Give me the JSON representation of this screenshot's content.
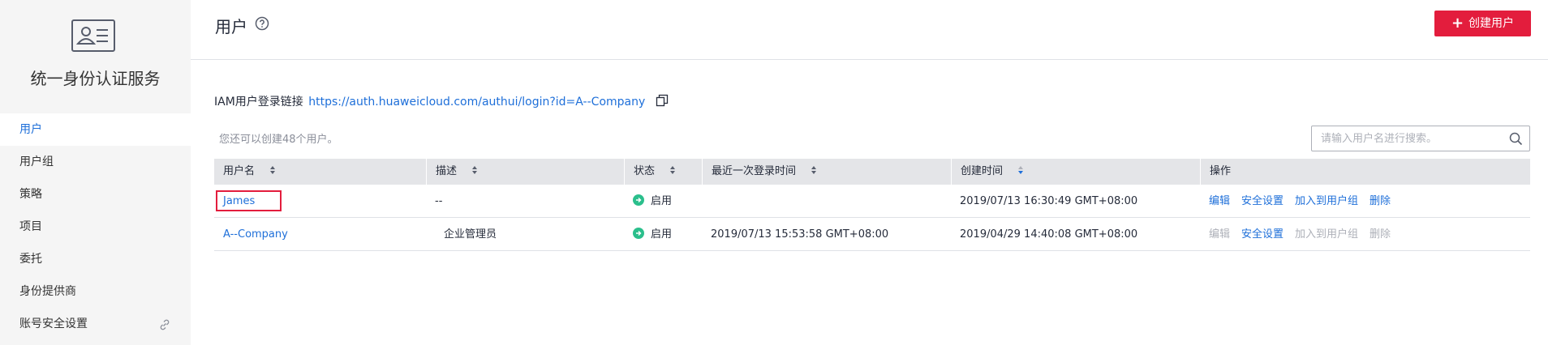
{
  "sidebar": {
    "title": "统一身份认证服务",
    "logo_icon": "id-card-icon",
    "items": [
      {
        "label": "用户",
        "active": true
      },
      {
        "label": "用户组"
      },
      {
        "label": "策略"
      },
      {
        "label": "项目"
      },
      {
        "label": "委托"
      },
      {
        "label": "身份提供商"
      },
      {
        "label": "账号安全设置",
        "icon": "link-icon"
      }
    ]
  },
  "header": {
    "title": "用户",
    "help_icon": "question-circle-icon",
    "create_button": "创建用户",
    "create_icon": "plus-icon"
  },
  "login_link": {
    "label": "IAM用户登录链接",
    "url": "https://auth.huaweicloud.com/authui/login?id=A--Company",
    "copy_icon": "copy-icon"
  },
  "quota_text": "您还可以创建48个用户。",
  "search": {
    "placeholder": "请输入用户名进行搜索。",
    "icon": "search-icon"
  },
  "table": {
    "columns": [
      "用户名",
      "描述",
      "状态",
      "最近一次登录时间",
      "创建时间",
      "操作"
    ],
    "rows": [
      {
        "username": "James",
        "description": "--",
        "status": "启用",
        "last_login": "",
        "created": "2019/07/13 16:30:49 GMT+08:00",
        "actions": [
          "编辑",
          "安全设置",
          "加入到用户组",
          "删除"
        ],
        "highlighted": true
      },
      {
        "username": "A--Company",
        "description": "企业管理员",
        "status": "启用",
        "last_login": "2019/07/13 15:53:58 GMT+08:00",
        "created": "2019/04/29 14:40:08 GMT+08:00",
        "actions": [
          "编辑",
          "安全设置",
          "加入到用户组",
          "删除"
        ]
      }
    ]
  },
  "colors": {
    "accent": "#1e6fd9",
    "primary_button": "#e31d3d",
    "status_ok": "#2bbf8c",
    "sort_active": "#1e6fd9"
  }
}
